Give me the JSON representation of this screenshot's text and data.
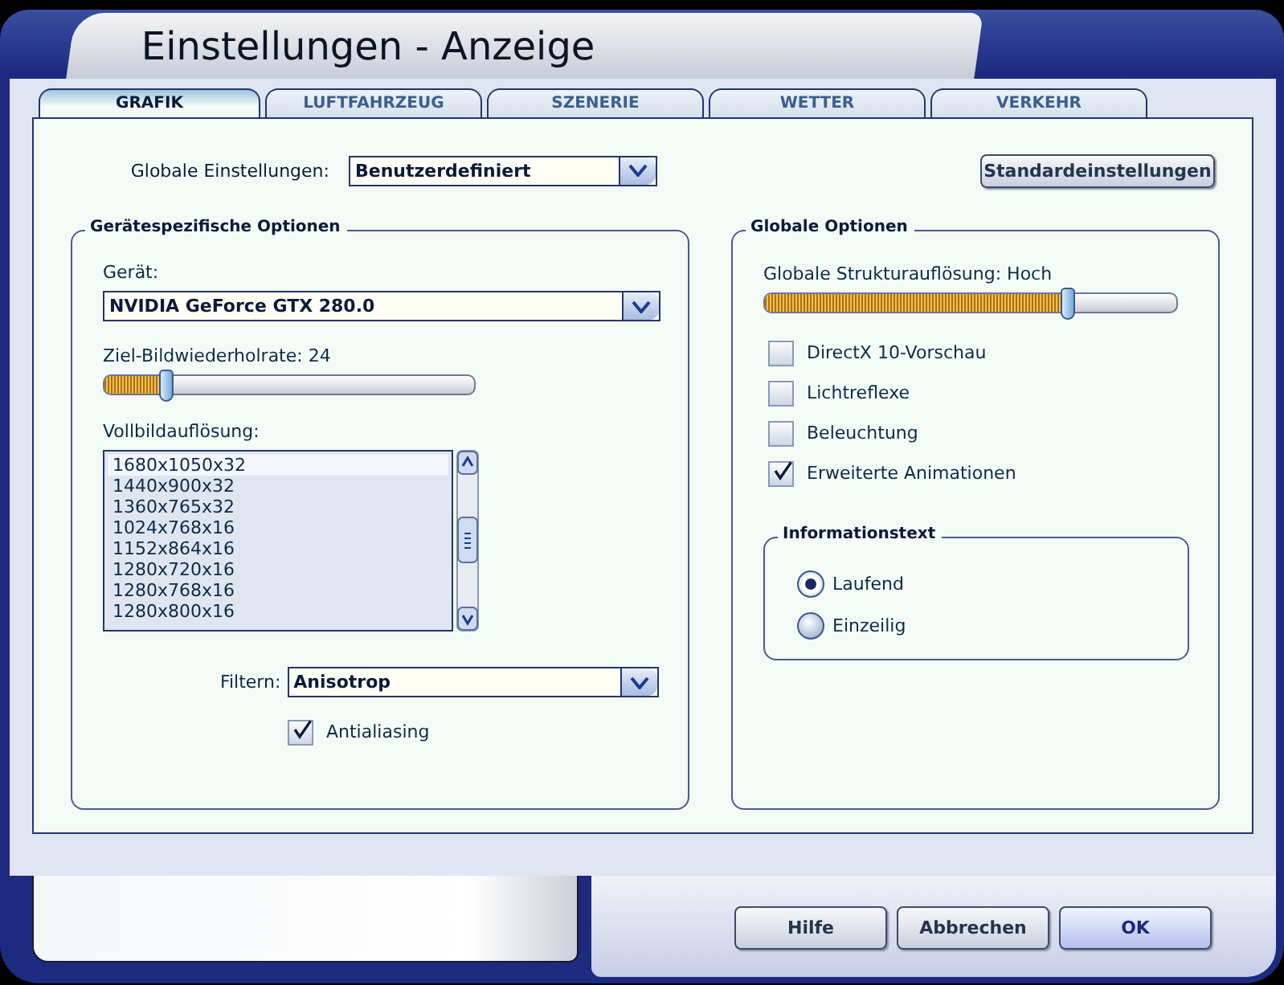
{
  "window": {
    "title": "Einstellungen - Anzeige"
  },
  "tabs": [
    {
      "label": "GRAFIK",
      "selected": true
    },
    {
      "label": "LUFTFAHRZEUG",
      "selected": false
    },
    {
      "label": "SZENERIE",
      "selected": false
    },
    {
      "label": "WETTER",
      "selected": false
    },
    {
      "label": "VERKEHR",
      "selected": false
    }
  ],
  "global_settings": {
    "label": "Globale Einstellungen:",
    "value": "Benutzerdefiniert"
  },
  "defaults_button": "Standardeinstellungen",
  "device_options": {
    "title": "Gerätespezifische Optionen",
    "device": {
      "label": "Gerät:",
      "value": "NVIDIA GeForce GTX 280.0"
    },
    "refresh_rate": {
      "label": "Ziel-Bildwiederholrate: 24",
      "level": 0.17
    },
    "resolution": {
      "label": "Vollbildauflösung:",
      "items": [
        {
          "text": "1680x1050x32",
          "selected": true
        },
        {
          "text": "1440x900x32",
          "selected": false
        },
        {
          "text": "1360x765x32",
          "selected": false
        },
        {
          "text": "1024x768x16",
          "selected": false
        },
        {
          "text": "1152x864x16",
          "selected": false
        },
        {
          "text": "1280x720x16",
          "selected": false
        },
        {
          "text": "1280x768x16",
          "selected": false
        },
        {
          "text": "1280x800x16",
          "selected": false
        }
      ]
    },
    "filter": {
      "label": "Filtern:",
      "value": "Anisotrop"
    },
    "antialiasing": {
      "label": "Antialiasing",
      "checked": true
    }
  },
  "global_options": {
    "title": "Globale Optionen",
    "texture": {
      "label": "Globale Strukturauflösung: Hoch",
      "level": 0.74
    },
    "checkboxes": [
      {
        "label": "DirectX 10-Vorschau",
        "checked": false
      },
      {
        "label": "Lichtreflexe",
        "checked": false
      },
      {
        "label": "Beleuchtung",
        "checked": false
      },
      {
        "label": "Erweiterte Animationen",
        "checked": true
      }
    ],
    "info_text": {
      "title": "Informationstext",
      "options": [
        {
          "label": "Laufend",
          "selected": true
        },
        {
          "label": "Einzeilig",
          "selected": false
        }
      ]
    }
  },
  "buttons": [
    {
      "label": "Hilfe",
      "default": false
    },
    {
      "label": "Abbrechen",
      "default": false
    },
    {
      "label": "OK",
      "default": true
    }
  ]
}
